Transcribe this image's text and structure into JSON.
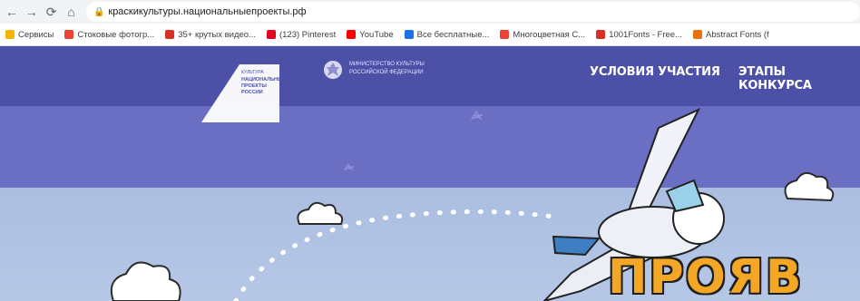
{
  "browser": {
    "url": "краскикультуры.национальныепроекты.рф"
  },
  "bookmarks": [
    {
      "label": "Сервисы",
      "color": "#f4b400"
    },
    {
      "label": "Стоковые фотогр...",
      "color": "#ea4335"
    },
    {
      "label": "35+ крутых видео...",
      "color": "#d93025"
    },
    {
      "label": "(123) Pinterest",
      "color": "#e60023"
    },
    {
      "label": "YouTube",
      "color": "#ff0000"
    },
    {
      "label": "Все бесплатные...",
      "color": "#1a73e8"
    },
    {
      "label": "Многоцветная С...",
      "color": "#ea4335"
    },
    {
      "label": "1001Fonts - Free...",
      "color": "#d93025"
    },
    {
      "label": "Abstract Fonts (f",
      "color": "#e8710a"
    }
  ],
  "site": {
    "nav": [
      "УСЛОВИЯ УЧАСТИЯ",
      "ЭТАПЫ КОНКУРСА"
    ],
    "logo_left": {
      "small": "КУЛЬТУРА",
      "lines": [
        "НАЦИОНАЛЬНЫЕ",
        "ПРОЕКТЫ",
        "РОССИИ"
      ]
    },
    "logo_right": [
      "МИНИСТЕРСТВО КУЛЬТУРЫ",
      "РОССИЙСКОЙ ФЕДЕРАЦИИ"
    ],
    "title_partial": "ПРОЯВ",
    "colors": {
      "header": "#4c50a7",
      "sky": "#b6c7e6",
      "title": "#f4a724"
    }
  }
}
